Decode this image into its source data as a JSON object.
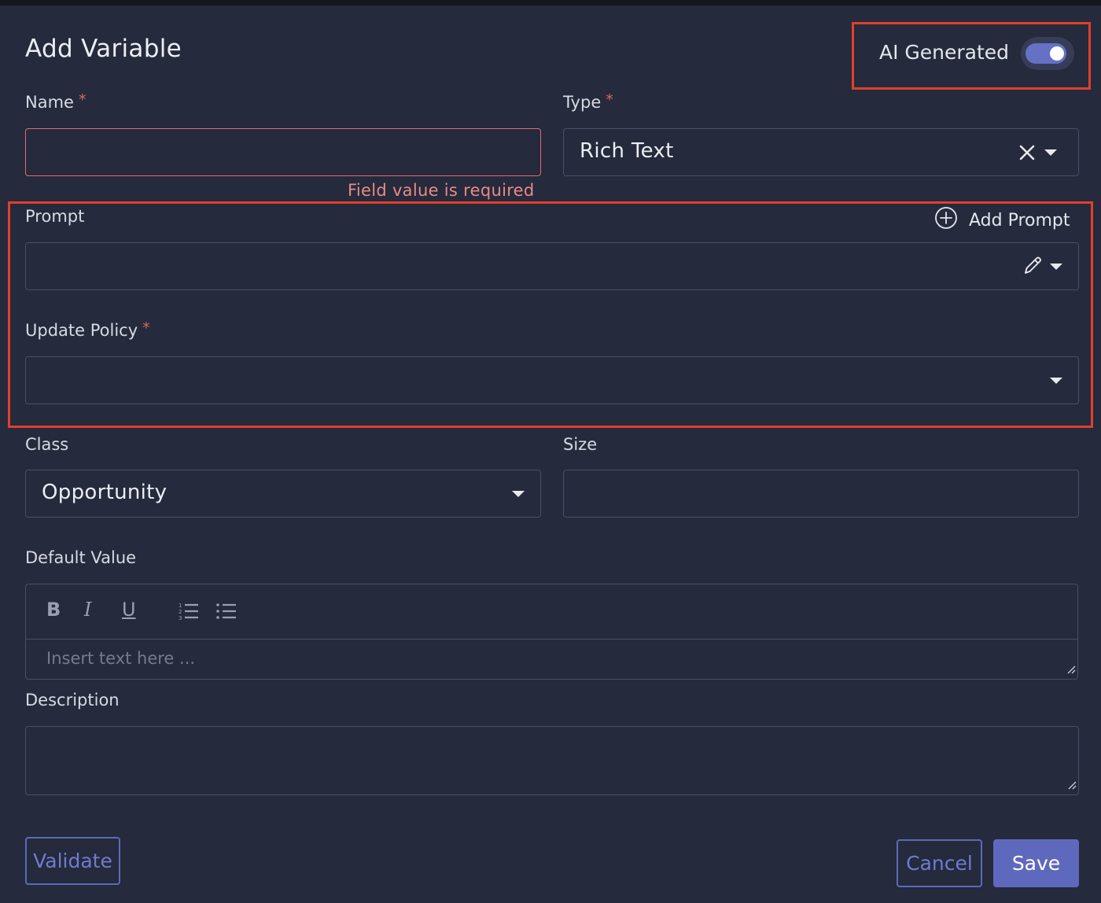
{
  "dialog": {
    "title": "Add Variable",
    "ai_generated_label": "AI Generated",
    "ai_generated_on": true
  },
  "name_field": {
    "label": "Name",
    "required_mark": "*",
    "value": "",
    "error": "Field value is required"
  },
  "type_field": {
    "label": "Type",
    "required_mark": "*",
    "value": "Rich Text"
  },
  "prompt_field": {
    "label": "Prompt",
    "add_label": "Add Prompt",
    "value": ""
  },
  "update_policy_field": {
    "label": "Update Policy",
    "required_mark": "*",
    "value": ""
  },
  "class_field": {
    "label": "Class",
    "value": "Opportunity"
  },
  "size_field": {
    "label": "Size",
    "value": ""
  },
  "default_value": {
    "label": "Default Value",
    "placeholder": "Insert text here ...",
    "toolbar": [
      "bold-icon",
      "italic-icon",
      "underline-icon",
      "ordered-list-icon",
      "bullet-list-icon"
    ]
  },
  "description_field": {
    "label": "Description",
    "value": ""
  },
  "buttons": {
    "validate": "Validate",
    "cancel": "Cancel",
    "save": "Save"
  },
  "colors": {
    "accent": "#5e69bd",
    "error": "#e06a7a",
    "highlight": "#e0402c",
    "background": "#252a3c"
  }
}
